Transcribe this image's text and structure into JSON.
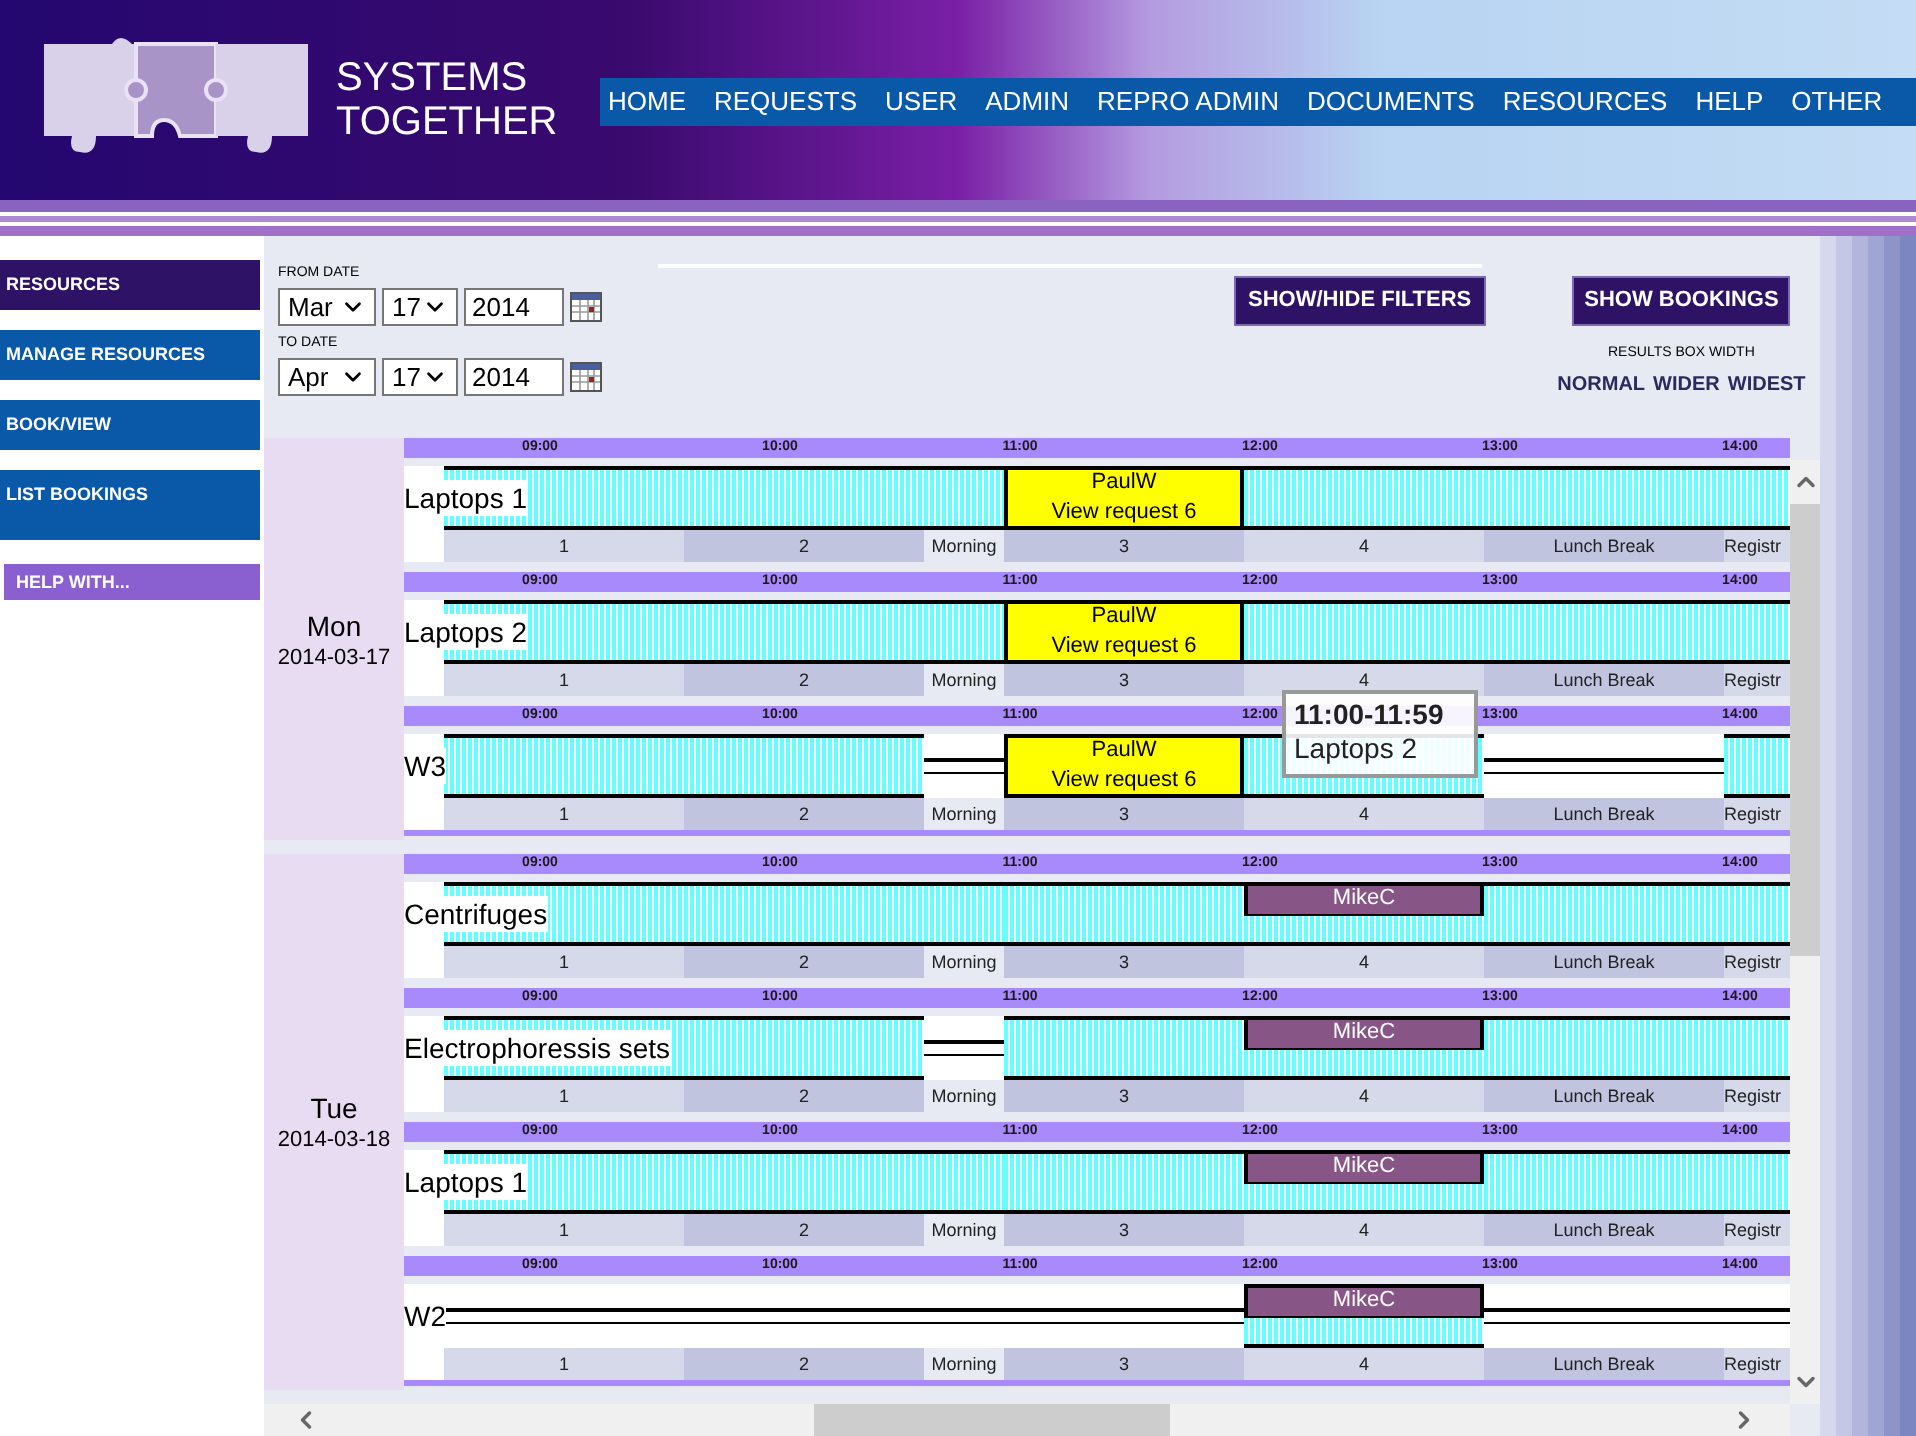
{
  "header": {
    "brand": "SYSTEMS TOGETHER"
  },
  "nav": [
    "HOME",
    "REQUESTS",
    "USER",
    "ADMIN",
    "REPRO ADMIN",
    "DOCUMENTS",
    "RESOURCES",
    "HELP",
    "OTHER"
  ],
  "sidebar": [
    {
      "label": "RESOURCES",
      "kind": "menu",
      "selected": true
    },
    {
      "label": "MANAGE RESOURCES",
      "kind": "menu",
      "selected": false
    },
    {
      "label": "BOOK/VIEW",
      "kind": "menu",
      "selected": false
    },
    {
      "label": "LIST BOOKINGS",
      "kind": "tall",
      "selected": false
    },
    {
      "label": "HELP WITH...",
      "kind": "help",
      "selected": false
    }
  ],
  "filters": {
    "from_label": "FROM DATE",
    "from": {
      "month": "Mar",
      "day": "17",
      "year": "2014"
    },
    "to_label": "TO DATE",
    "to": {
      "month": "Apr",
      "day": "17",
      "year": "2014"
    }
  },
  "buttons": [
    "SHOW/HIDE FILTERS",
    "SHOW BOOKINGS"
  ],
  "width_label": "RESULTS BOX WIDTH",
  "width_options": [
    "NORMAL",
    "WIDER",
    "WIDEST"
  ],
  "days": [
    {
      "day": "Mon",
      "date": "2014-03-17",
      "resources": [
        {
          "name": "Laptops 1",
          "hours": [
            "09:00",
            "10:00",
            "11:00",
            "12:00",
            "13:00",
            "14:00"
          ],
          "slots": [
            {
              "period": "1",
              "kind": "free"
            },
            {
              "period": "2",
              "kind": "free"
            },
            {
              "period": "Morning",
              "kind": "free"
            },
            {
              "period": "3",
              "kind": "booking",
              "user": "PaulW",
              "link": "View request 6"
            },
            {
              "period": "4",
              "kind": "free"
            },
            {
              "period": "Lunch Break",
              "kind": "free"
            },
            {
              "period": "Registr",
              "kind": "free"
            }
          ]
        },
        {
          "name": "Laptops 2",
          "hours": [
            "09:00",
            "10:00",
            "11:00",
            "12:00",
            "13:00",
            "14:00"
          ],
          "slots": [
            {
              "period": "1",
              "kind": "free"
            },
            {
              "period": "2",
              "kind": "free"
            },
            {
              "period": "Morning",
              "kind": "free"
            },
            {
              "period": "3",
              "kind": "booking",
              "user": "PaulW",
              "link": "View request 6"
            },
            {
              "period": "4",
              "kind": "free"
            },
            {
              "period": "Lunch Break",
              "kind": "free"
            },
            {
              "period": "Registr",
              "kind": "free"
            }
          ]
        },
        {
          "name": "W3",
          "hours": [
            "09:00",
            "10:00",
            "11:00",
            "12:00",
            "13:00",
            "14:00"
          ],
          "slots": [
            {
              "period": "1",
              "kind": "free"
            },
            {
              "period": "2",
              "kind": "free"
            },
            {
              "period": "Morning",
              "kind": "closed"
            },
            {
              "period": "3",
              "kind": "booking",
              "user": "PaulW",
              "link": "View request 6"
            },
            {
              "period": "4",
              "kind": "free"
            },
            {
              "period": "Lunch Break",
              "kind": "closed"
            },
            {
              "period": "Registr",
              "kind": "free"
            }
          ]
        }
      ]
    },
    {
      "day": "Tue",
      "date": "2014-03-18",
      "resources": [
        {
          "name": "Centrifuges",
          "hours": [
            "09:00",
            "10:00",
            "11:00",
            "12:00",
            "13:00",
            "14:00"
          ],
          "slots": [
            {
              "period": "1",
              "kind": "free"
            },
            {
              "period": "2",
              "kind": "free"
            },
            {
              "period": "Morning",
              "kind": "free"
            },
            {
              "period": "3",
              "kind": "free"
            },
            {
              "period": "4",
              "kind": "partial",
              "user": "MikeC"
            },
            {
              "period": "Lunch Break",
              "kind": "free"
            },
            {
              "period": "Registr",
              "kind": "free"
            }
          ]
        },
        {
          "name": "Electrophoressis sets",
          "hours": [
            "09:00",
            "10:00",
            "11:00",
            "12:00",
            "13:00",
            "14:00"
          ],
          "slots": [
            {
              "period": "1",
              "kind": "free"
            },
            {
              "period": "2",
              "kind": "free"
            },
            {
              "period": "Morning",
              "kind": "closed"
            },
            {
              "period": "3",
              "kind": "free"
            },
            {
              "period": "4",
              "kind": "partial",
              "user": "MikeC"
            },
            {
              "period": "Lunch Break",
              "kind": "free"
            },
            {
              "period": "Registr",
              "kind": "free"
            }
          ]
        },
        {
          "name": "Laptops 1",
          "hours": [
            "09:00",
            "10:00",
            "11:00",
            "12:00",
            "13:00",
            "14:00"
          ],
          "slots": [
            {
              "period": "1",
              "kind": "free"
            },
            {
              "period": "2",
              "kind": "free"
            },
            {
              "period": "Morning",
              "kind": "free"
            },
            {
              "period": "3",
              "kind": "free"
            },
            {
              "period": "4",
              "kind": "partial",
              "user": "MikeC"
            },
            {
              "period": "Lunch Break",
              "kind": "free"
            },
            {
              "period": "Registr",
              "kind": "free"
            }
          ]
        },
        {
          "name": "W2",
          "hours": [
            "09:00",
            "10:00",
            "11:00",
            "12:00",
            "13:00",
            "14:00"
          ],
          "slots": [
            {
              "period": "1",
              "kind": "closed"
            },
            {
              "period": "2",
              "kind": "closed"
            },
            {
              "period": "Morning",
              "kind": "closed"
            },
            {
              "period": "3",
              "kind": "closed"
            },
            {
              "period": "4",
              "kind": "partial",
              "user": "MikeC"
            },
            {
              "period": "Lunch Break",
              "kind": "closed"
            },
            {
              "period": "Registr",
              "kind": "closed"
            }
          ]
        }
      ]
    }
  ],
  "tooltip": {
    "time": "11:00-11:59",
    "resource": "Laptops 2"
  }
}
